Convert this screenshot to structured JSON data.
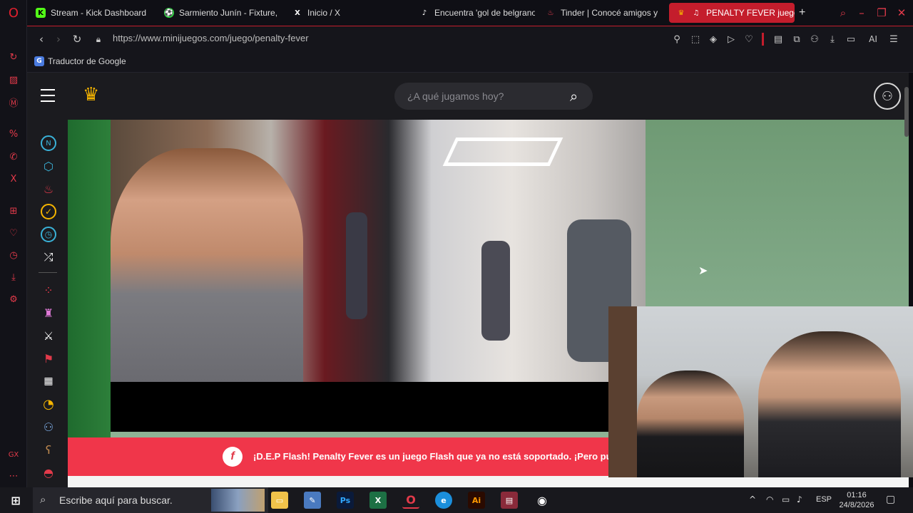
{
  "browser": {
    "tabs": [
      {
        "label": "Stream - Kick Dashboard",
        "icon": "kick-icon",
        "color": "#53fc18"
      },
      {
        "label": "Sarmiento Junín - Fixture,",
        "icon": "soccer-ball-icon",
        "color": "#2ecc40"
      },
      {
        "label": "Inicio / X",
        "icon": "x-logo-icon",
        "color": "#ffffff"
      },
      {
        "label": "Encuentra 'gol de belgrano",
        "icon": "tiktok-icon",
        "color": "#ffffff"
      },
      {
        "label": "Tinder | Conocé amigos y",
        "icon": "tinder-flame-icon",
        "color": "#ff4458"
      },
      {
        "label": "PENALTY FEVER juego",
        "icon": "crown-icon",
        "color": "#f5b400",
        "active": true
      }
    ],
    "new_tab": "+",
    "url": "https://www.minijuegos.com/juego/penalty-fever",
    "url_domain": "minijuegos.com",
    "ai_label": "AI",
    "bookmark": "Traductor de Google"
  },
  "site": {
    "search_placeholder": "¿A qué jugamos hoy?",
    "accent": "#f5b400"
  },
  "banner": {
    "text": "¡D.E.P Flash! Penalty Fever es un juego Flash que ya no está soportado. ¡Pero puedes",
    "color": "#f0364a"
  },
  "taskbar": {
    "search_placeholder": "Escribe aquí para buscar.",
    "language": "ESP",
    "time": "01:16",
    "date": "24/8/2026"
  }
}
